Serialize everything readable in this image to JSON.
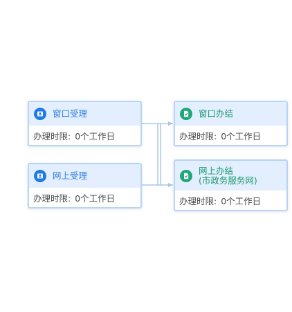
{
  "colors": {
    "node_border": "#b9d4f2",
    "node_header_bg": "#e3efff",
    "accept_accent": "#1e7be6",
    "complete_accent": "#1fa77a",
    "connector": "#a9c6ea"
  },
  "nodes": {
    "window_accept": {
      "title": "窗口受理",
      "icon": "user-badge-icon",
      "limit_label": "办理时限:",
      "limit_value": "0个工作日"
    },
    "online_accept": {
      "title": "网上受理",
      "icon": "user-badge-icon",
      "limit_label": "办理时限:",
      "limit_value": "0个工作日"
    },
    "window_complete": {
      "title": "窗口办结",
      "icon": "document-check-icon",
      "limit_label": "办理时限:",
      "limit_value": "0个工作日"
    },
    "online_complete": {
      "title_line1": "网上办结",
      "title_line2": "(市政务服务网)",
      "icon": "document-check-icon",
      "limit_label": "办理时限:",
      "limit_value": "0个工作日"
    }
  }
}
